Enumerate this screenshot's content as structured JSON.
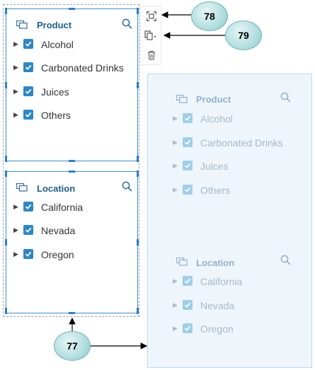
{
  "panels": {
    "product": {
      "title": "Product",
      "items": [
        {
          "label": "Alcohol",
          "checked": true
        },
        {
          "label": "Carbonated Drinks",
          "checked": true
        },
        {
          "label": "Juices",
          "checked": true
        },
        {
          "label": "Others",
          "checked": true
        }
      ]
    },
    "location": {
      "title": "Location",
      "items": [
        {
          "label": "California",
          "checked": true
        },
        {
          "label": "Nevada",
          "checked": true
        },
        {
          "label": "Oregon",
          "checked": true
        }
      ]
    }
  },
  "toolbar": {
    "icons": [
      "focus-frame-icon",
      "duplicate-icon",
      "trash-icon"
    ]
  },
  "callouts": {
    "c77": "77",
    "c78": "78",
    "c79": "79"
  },
  "colors": {
    "accent": "#2e86c9",
    "panel_border": "#8fc3e8",
    "title": "#1f5c8a",
    "ghost_bg": "#eef6fc",
    "callout": "#bfe4e5"
  }
}
